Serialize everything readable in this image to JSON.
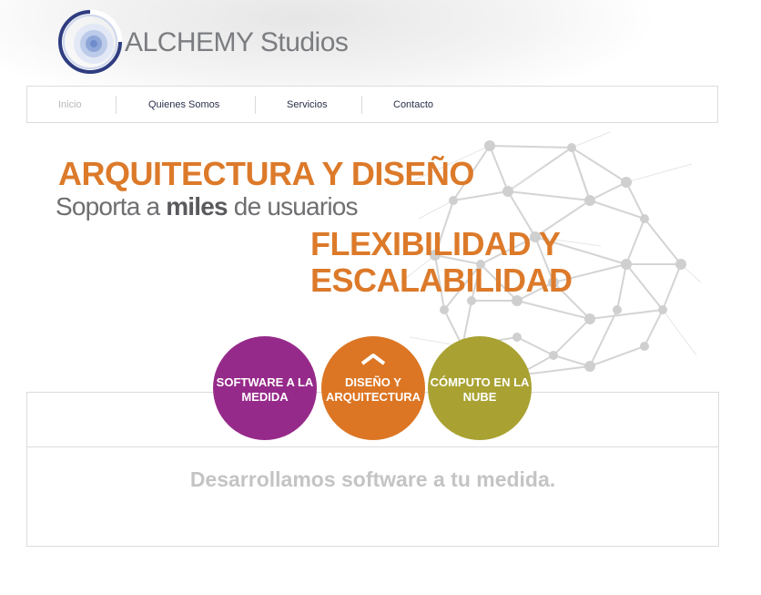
{
  "logo": {
    "brand_bold": "ALCHEMY",
    "brand_light": "Studios",
    "icon": "alchemy-ring-logo"
  },
  "nav": {
    "items": [
      {
        "label": "Inicio",
        "active": true
      },
      {
        "label": "Quienes Somos",
        "active": false
      },
      {
        "label": "Servicios",
        "active": false
      },
      {
        "label": "Contacto",
        "active": false
      }
    ]
  },
  "hero": {
    "line1": "ARQUITECTURA Y DISEÑO",
    "line2_pre": "Soporta a ",
    "line2_bold": "miles",
    "line2_post": " de usuarios",
    "line3a": "FLEXIBILIDAD Y",
    "line3b": "ESCALABILIDAD",
    "background_icon": "network-graph"
  },
  "features": [
    {
      "label": "SOFTWARE A LA MEDIDA",
      "color": "#962a8a"
    },
    {
      "label": "DISEÑO Y ARQUITECTURA",
      "color": "#dc7624",
      "icon": "chevron-up-icon"
    },
    {
      "label": "CÓMPUTO EN LA NUBE",
      "color": "#a9a233"
    }
  ],
  "tagline": "Desarrollamos software a tu medida.",
  "colors": {
    "accent_orange": "#dc7a2a",
    "purple": "#962a8a",
    "olive": "#a9a233",
    "nav_text": "#2b2f4a"
  }
}
